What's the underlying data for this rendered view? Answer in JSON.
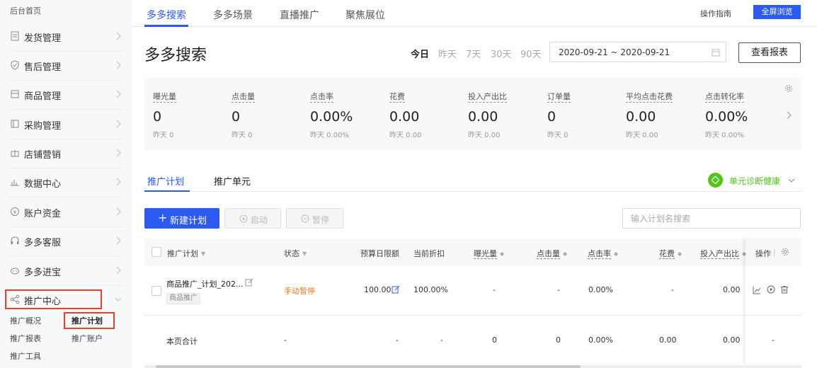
{
  "sidebar": {
    "home": "后台首页",
    "items": [
      {
        "label": "发货管理",
        "icon": "document-icon"
      },
      {
        "label": "售后管理",
        "icon": "shield-icon"
      },
      {
        "label": "商品管理",
        "icon": "box-icon"
      },
      {
        "label": "采购管理",
        "icon": "clipboard-icon"
      },
      {
        "label": "店铺营销",
        "icon": "gift-icon"
      },
      {
        "label": "数据中心",
        "icon": "bar-chart-icon"
      },
      {
        "label": "账户资金",
        "icon": "money-icon"
      },
      {
        "label": "多多客服",
        "icon": "headset-icon"
      },
      {
        "label": "多多进宝",
        "icon": "treasure-icon"
      },
      {
        "label": "推广中心",
        "icon": "share-icon"
      }
    ],
    "promo_sub": [
      "推广概况",
      "推广计划",
      "推广报表",
      "推广账户",
      "推广工具"
    ]
  },
  "top_tabs": [
    "多多搜索",
    "多多场景",
    "直播推广",
    "聚焦展位"
  ],
  "header": {
    "guide": "操作指南",
    "fullscreen": "全屏浏览"
  },
  "page_title": "多多搜索",
  "date_ranges": [
    "今日",
    "昨天",
    "7天",
    "30天",
    "90天"
  ],
  "date_value": "2020-09-21 ~ 2020-09-21",
  "report_button": "查看报表",
  "metrics": [
    {
      "name": "曝光量",
      "value": "0",
      "yesterday": "昨天 0"
    },
    {
      "name": "点击量",
      "value": "0",
      "yesterday": "昨天 0"
    },
    {
      "name": "点击率",
      "value": "0.00%",
      "yesterday": "昨天 0.00%"
    },
    {
      "name": "花费",
      "value": "0.00",
      "yesterday": "昨天 0.00"
    },
    {
      "name": "投入产出比",
      "value": "0.00",
      "yesterday": "昨天 0.00"
    },
    {
      "name": "订单量",
      "value": "0",
      "yesterday": "昨天 0"
    },
    {
      "name": "平均点击花费",
      "value": "0.00",
      "yesterday": "昨天 0.00"
    },
    {
      "name": "点击转化率",
      "value": "0.00%",
      "yesterday": "昨天 0.00%"
    }
  ],
  "sub_tabs": [
    "推广计划",
    "推广单元"
  ],
  "health": "单元诊断健康",
  "actions": {
    "new_plan": "新建计划",
    "start": "启动",
    "pause": "暂停"
  },
  "search": {
    "placeholder": "输入计划名搜索"
  },
  "table": {
    "headers": {
      "plan": "推广计划",
      "status": "状态",
      "budget": "预算日限额",
      "discount": "当前折扣",
      "impressions": "曝光量",
      "clicks": "点击量",
      "ctr": "点击率",
      "cost": "花费",
      "roi": "投入产出比",
      "ops": "操作"
    },
    "row": {
      "plan_name": "商品推广_计划_202...",
      "plan_tag": "商品推广",
      "status": "手动暂停",
      "budget": "100.00",
      "discount": "100.00%",
      "impressions": "-",
      "clicks": "-",
      "ctr": "0.00%",
      "cost": "-",
      "roi": "0.00"
    },
    "total": {
      "label": "本页合计",
      "status": "-",
      "budget": "-",
      "discount": "-",
      "impressions": "0",
      "clicks": "0",
      "ctr": "0.00%",
      "cost": "0.00",
      "roi": "0.00",
      "ops": "-"
    }
  }
}
